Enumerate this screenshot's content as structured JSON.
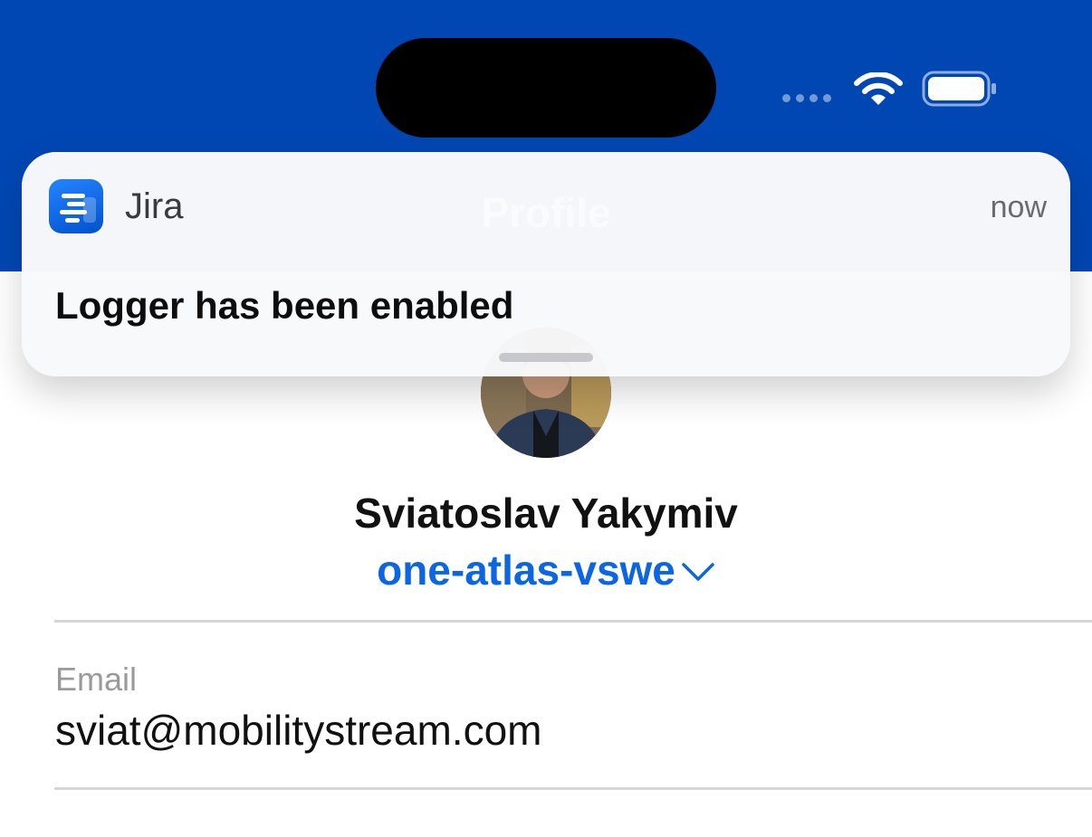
{
  "header": {
    "title": "Profile",
    "background_color": "#0047B3"
  },
  "status_bar": {
    "wifi_icon": "wifi-icon",
    "battery_icon": "battery-icon"
  },
  "notification": {
    "app_name": "Jira",
    "time": "now",
    "message": "Logger has been enabled",
    "app_icon": "jira-app-icon"
  },
  "profile": {
    "name": "Sviatoslav Yakymiv",
    "site": "one-atlas-vswe",
    "site_color": "#0C66E4"
  },
  "fields": [
    {
      "label": "Email",
      "value": "sviat@mobilitystream.com"
    }
  ]
}
